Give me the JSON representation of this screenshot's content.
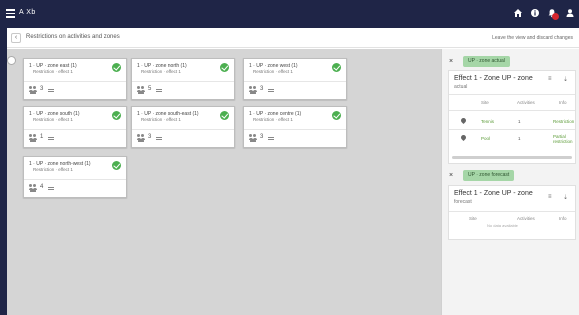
{
  "appbar": {
    "menu_icon": "hamburger-icon",
    "title": "A Xb",
    "icons": [
      "home-icon",
      "info-icon",
      "bell-icon",
      "user-icon"
    ],
    "notification_color": "#d6262e"
  },
  "subheader": {
    "back_icon": "chevron-left-icon",
    "text": "Restrictions on activities and zones",
    "right_text": "Leave the view and discard changes"
  },
  "cards": [
    {
      "title": "1 · UP · zone east (1)",
      "subtitle": "Restriction · effect 1",
      "count": "3",
      "status": "complete"
    },
    {
      "title": "1 · UP · zone north (1)",
      "subtitle": "Restriction · effect 1",
      "count": "5",
      "status": "complete"
    },
    {
      "title": "1 · UP · zone west (1)",
      "subtitle": "Restriction · effect 1",
      "count": "3",
      "status": "complete"
    },
    {
      "title": "1 · UP · zone south (1)",
      "subtitle": "Restriction · effect 1",
      "count": "1",
      "status": "complete"
    },
    {
      "title": "1 · UP · zone south-east (1)",
      "subtitle": "Restriction · effect 1",
      "count": "3",
      "status": "complete"
    },
    {
      "title": "1 · UP · zone centre (1)",
      "subtitle": "Restriction · effect 1",
      "count": "3",
      "status": "complete"
    },
    {
      "title": "1 · UP · zone north-west (1)",
      "subtitle": "Restriction · effect 1",
      "count": "4",
      "status": "complete"
    }
  ],
  "panel": {
    "section1": {
      "close": "×",
      "chip": "UP · zone actual",
      "title_line1": "Effect 1 - Zone UP - zone",
      "title_line2": "actual",
      "columns": [
        "Site",
        "Activities",
        "Info"
      ],
      "rows": [
        {
          "site": "Tennis",
          "activities": "1",
          "info": "Restriction"
        },
        {
          "site": "Pool",
          "activities": "1",
          "info": "Partial restriction"
        }
      ]
    },
    "section2": {
      "close": "×",
      "chip": "UP · zone forecast",
      "title_line1": "Effect 1 - Zone UP - zone",
      "title_line2": "forecast",
      "columns": [
        "Site",
        "Activities",
        "Info"
      ],
      "empty": "No data available"
    }
  }
}
